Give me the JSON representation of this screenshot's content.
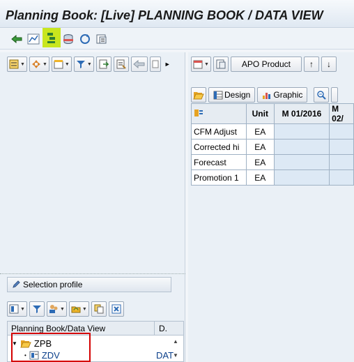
{
  "window": {
    "title": "Planning Book: [Live] PLANNING BOOK / DATA VIEW"
  },
  "app_toolbar": {
    "icons": [
      "back-arrow-icon",
      "chart-line-icon",
      "selector-toggle-icon",
      "database-icon",
      "refresh-icon",
      "variables-icon"
    ]
  },
  "left_toolbar": {
    "icons": [
      "select-icon",
      "move-icon",
      "header-icon",
      "filter-icon",
      "export-icon",
      "layout-icon",
      "back-icon",
      "more-icon"
    ],
    "scroll_right": "►"
  },
  "right_toolbar": {
    "apo_product_label": "APO Product",
    "up_label": "↑",
    "down_label": "↓"
  },
  "grid_tabs": {
    "design_label": "Design",
    "graphic_label": "Graphic"
  },
  "grid": {
    "headers": {
      "unit": "Unit",
      "m1": "M 01/2016",
      "m2": "M 02/"
    },
    "rows": [
      {
        "label": "CFM Adjust",
        "unit": "EA"
      },
      {
        "label": "Corrected hi",
        "unit": "EA"
      },
      {
        "label": "Forecast",
        "unit": "EA"
      },
      {
        "label": "Promotion 1",
        "unit": "EA"
      }
    ]
  },
  "selection_profile": {
    "label": "Selection profile"
  },
  "tree": {
    "col1": "Planning Book/Data View",
    "col2": "D.",
    "folder": "ZPB",
    "item": "ZDV",
    "item_desc": "DAT"
  },
  "colors": {
    "highlight": "#c8e61e",
    "red_box": "#d40000"
  }
}
